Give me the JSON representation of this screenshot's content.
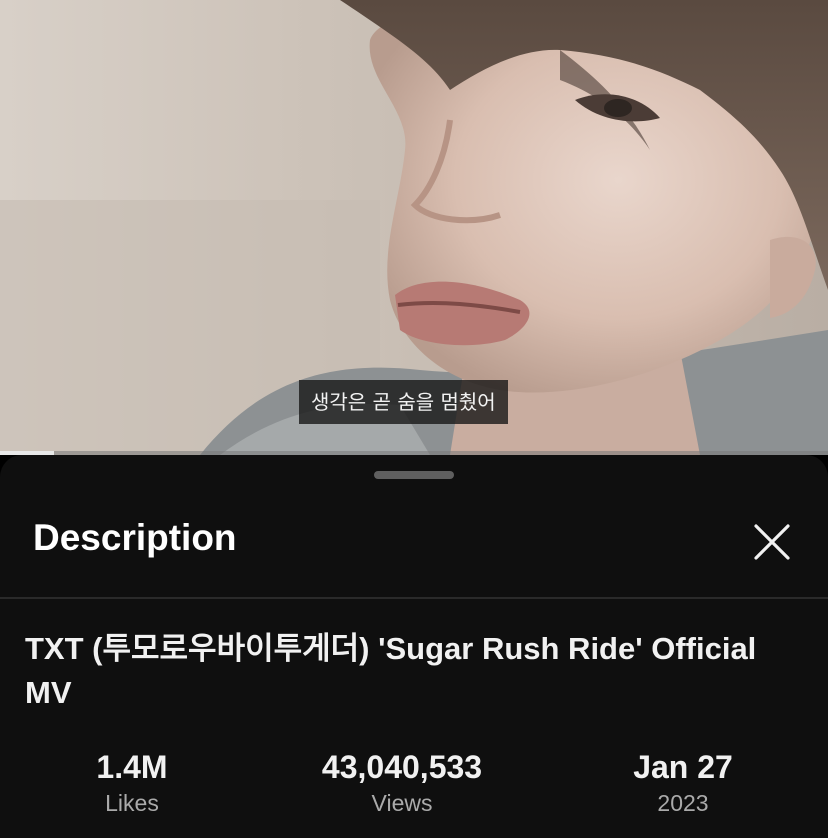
{
  "video": {
    "caption": "생각은 곧 숨을 멈췄어",
    "progress": 0.065
  },
  "sheet": {
    "title": "Description",
    "close_icon": "close-x-icon",
    "video_title": "TXT (투모로우바이투게더) 'Sugar Rush Ride' Official MV",
    "stats": [
      {
        "value": "1.4M",
        "label": "Likes"
      },
      {
        "value": "43,040,533",
        "label": "Views"
      },
      {
        "value": "Jan 27",
        "label": "2023"
      }
    ]
  },
  "colors": {
    "sheet_background": "#0f0f0f",
    "primary_text": "#f1f1f1",
    "secondary_text": "#aaaaaa",
    "caption_background": "#141414"
  }
}
